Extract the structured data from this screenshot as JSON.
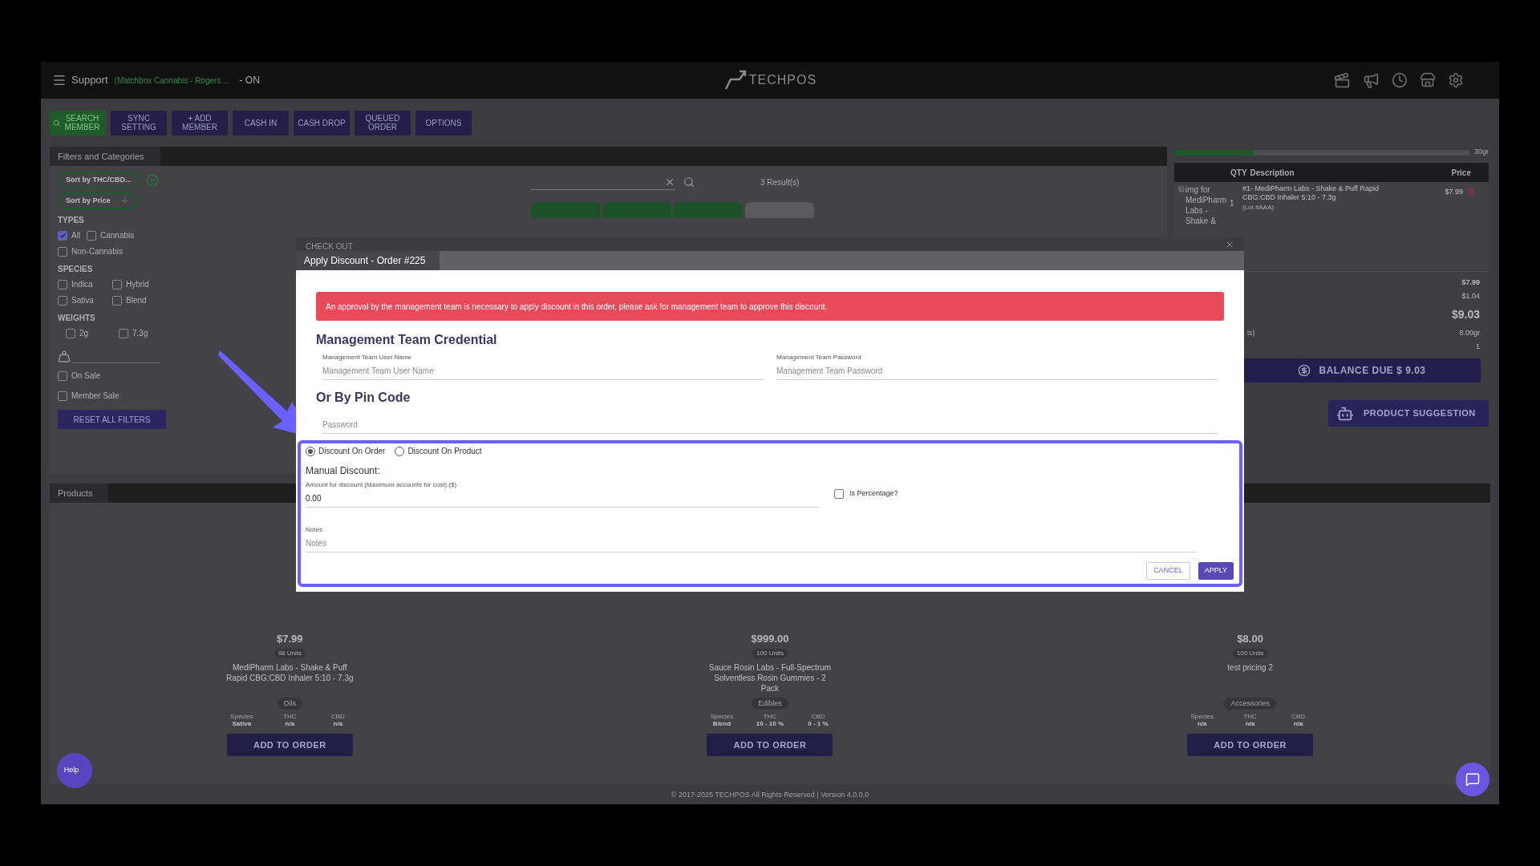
{
  "header": {
    "title": "Support",
    "store": "(Matchbox Cannabis - Rogers ...",
    "status": "- ON",
    "logo": "TECHPOS"
  },
  "toolbar": [
    {
      "label": "SEARCH MEMBER",
      "kind": "primary"
    },
    {
      "label": "SYNC SETTING",
      "kind": "default"
    },
    {
      "label": "+ ADD MEMBER",
      "kind": "default"
    },
    {
      "label": "CASH IN",
      "kind": "default"
    },
    {
      "label": "CASH DROP",
      "kind": "default"
    },
    {
      "label": "QUEUED ORDER",
      "kind": "default"
    },
    {
      "label": "OPTIONS",
      "kind": "default"
    }
  ],
  "filters": {
    "title": "Filters and Categories",
    "sort_buttons": [
      {
        "label": "Sort by THC/CBD...",
        "kind": "minus"
      },
      {
        "label": "Sort by Price",
        "kind": "plus"
      }
    ],
    "groups": [
      {
        "heading": "TYPES",
        "options": [
          {
            "label": "All",
            "checked": true
          },
          {
            "label": "Cannabis",
            "checked": false
          },
          {
            "label": "Non-Cannabis",
            "checked": false
          }
        ]
      },
      {
        "heading": "SPECIES",
        "options": [
          {
            "label": "Indica",
            "checked": false
          },
          {
            "label": "Hybrid",
            "checked": false
          },
          {
            "label": "Sativa",
            "checked": false
          },
          {
            "label": "Blend",
            "checked": false
          }
        ]
      },
      {
        "heading": "WEIGHTS",
        "options": [
          {
            "label": "2g",
            "checked": false
          },
          {
            "label": "7.3g",
            "checked": false
          }
        ]
      }
    ],
    "extras": [
      {
        "label": "On Sale",
        "checked": false
      },
      {
        "label": "Member Sale",
        "checked": false
      }
    ],
    "reset": "RESET ALL FILTERS",
    "results": "3 Result(s)",
    "category_tabs": [
      {
        "selected": true
      },
      {
        "selected": true
      },
      {
        "selected": true
      },
      {
        "selected": false
      }
    ]
  },
  "cart": {
    "weight": {
      "level": 0.27,
      "label": "30gr"
    },
    "columns": [
      "QTY",
      "Description",
      "Price"
    ],
    "item": {
      "image_alt": "img for MediPharm Labs - Shake &",
      "qty": "1",
      "description": "#1- MediPharm Labs - Shake & Puff Rapid CBG:CBD Inhaler 5:10 - 7.3g",
      "lot": "(Lot #AAA)",
      "price": "$7.99"
    },
    "summary": [
      {
        "value": "$7.99",
        "kind": "bold"
      },
      {
        "value": "$1.04",
        "kind": "plain"
      },
      {
        "value": "$9.03",
        "kind": "total"
      },
      {
        "label": "is)",
        "value": "8.00gr",
        "kind": "plain"
      },
      {
        "value": "1",
        "kind": "plain"
      }
    ],
    "balance": "BALANCE DUE $ 9.03",
    "suggestion": "PRODUCT SUGGESTION"
  },
  "products": {
    "title": "Products",
    "items": [
      {
        "price": "$7.99",
        "units": "98 Units",
        "name": "MediPharm Labs - Shake & Puff Rapid CBG:CBD Inhaler 5:10 - 7.3g",
        "category": "Oils",
        "specs": [
          {
            "label": "Species",
            "value": "Sativa"
          },
          {
            "label": "THC",
            "value": "n/a"
          },
          {
            "label": "CBD",
            "value": "n/a"
          }
        ],
        "button": "ADD TO ORDER"
      },
      {
        "price": "$999.00",
        "units": "100 Units",
        "name": "Sauce Rosin Labs - Full-Spectrum Solventless Rosin Gummies - 2 Pack",
        "category": "Edibles",
        "specs": [
          {
            "label": "Species",
            "value": "Blend"
          },
          {
            "label": "THC",
            "value": "10 - 10 %"
          },
          {
            "label": "CBD",
            "value": "0 - 1 %"
          }
        ],
        "button": "ADD TO ORDER"
      },
      {
        "price": "$8.00",
        "units": "100 Units",
        "name": "test pricing 2",
        "category": "Accessories",
        "specs": [
          {
            "label": "Species",
            "value": "n/a"
          },
          {
            "label": "THC",
            "value": "n/a"
          },
          {
            "label": "CBD",
            "value": "n/a"
          }
        ],
        "button": "ADD TO ORDER"
      }
    ]
  },
  "footer": "© 2017-2025 TECHPOS All Rights Reserved | Version 4.0.0.0",
  "help": "Help",
  "modal": {
    "behind_title": "CHECK OUT",
    "title": "Apply Discount - Order #225",
    "alert": "An approval by the management team is necessary to apply discount in this order, please ask for management team to approve this discount.",
    "credential_heading": "Management Team Credential",
    "username": {
      "label": "Management Team User Name",
      "placeholder": "Management Team User Name"
    },
    "password": {
      "label": "Management Team Password",
      "placeholder": "Management Team Password"
    },
    "pin_heading": "Or By Pin Code",
    "pin": {
      "placeholder": "Password"
    },
    "radios": [
      {
        "label": "Discount On Order",
        "selected": true
      },
      {
        "label": "Discount On Product",
        "selected": false
      }
    ],
    "manual_heading": "Manual Discount:",
    "amount": {
      "label": "Amount for discount (Maximum accounts for cost) ($)",
      "value": "0.00"
    },
    "percentage": {
      "label": "Is Percentage?",
      "checked": false
    },
    "notes": {
      "label": "Notes",
      "placeholder": "Notes"
    },
    "buttons": [
      {
        "label": "CANCEL",
        "kind": "outline"
      },
      {
        "label": "APPLY",
        "kind": "filled"
      }
    ]
  }
}
